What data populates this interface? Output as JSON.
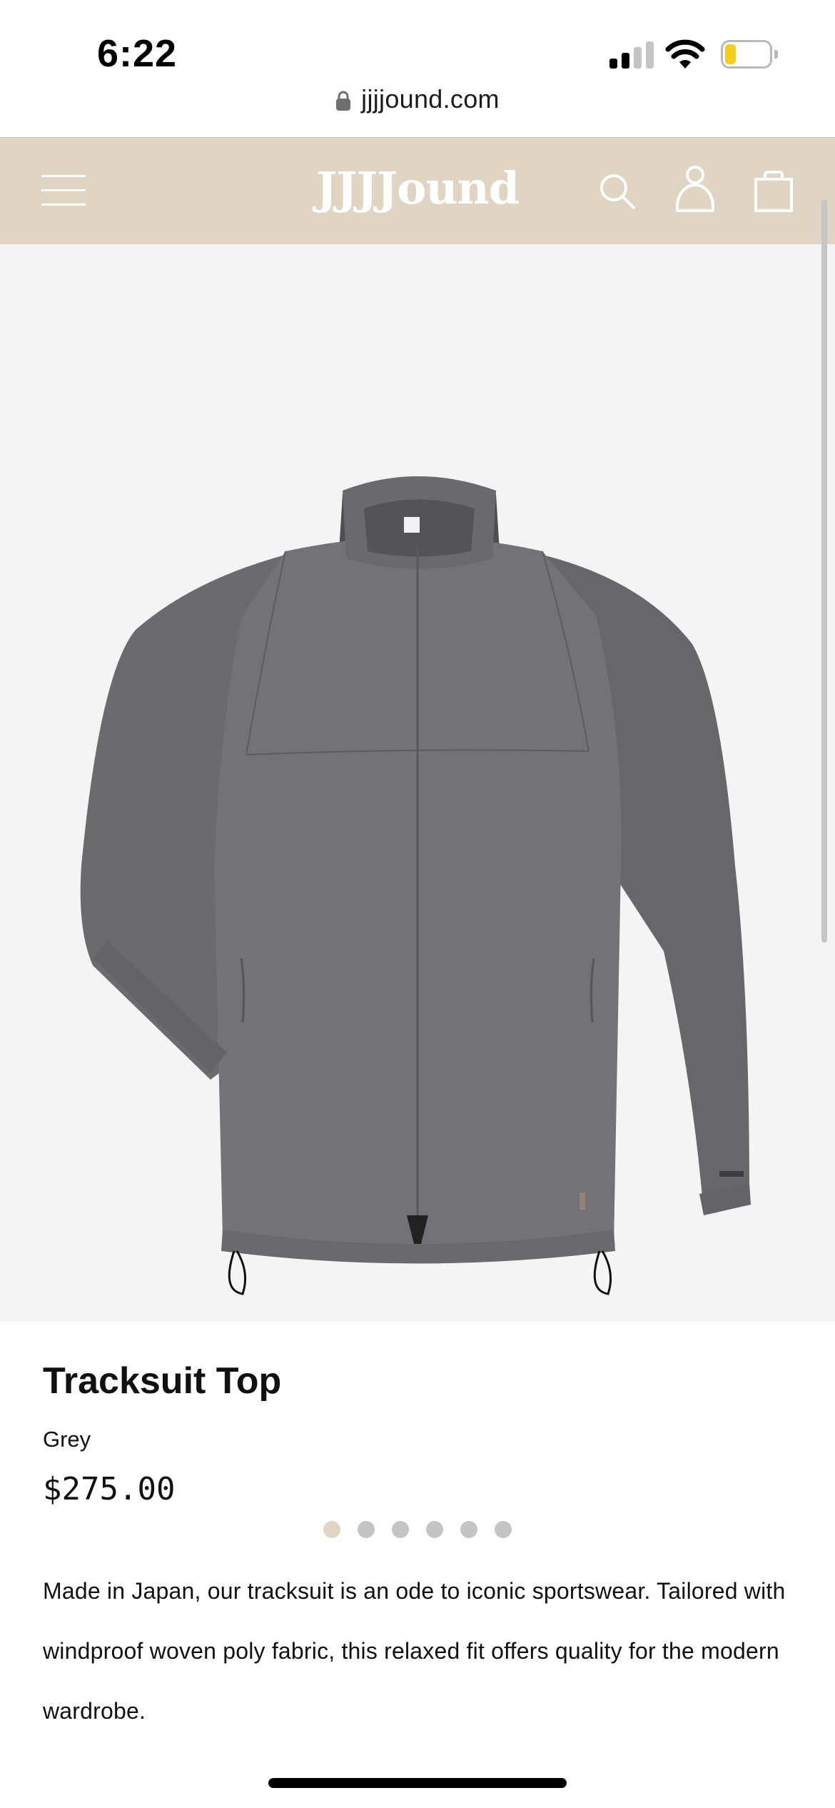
{
  "status_bar": {
    "time": "6:22",
    "battery_level": 0.25,
    "battery_color": "#f5cd1d"
  },
  "browser": {
    "url": "jjjjound.com",
    "lock_icon": "lock-icon"
  },
  "header": {
    "brand": "JJJJound",
    "background": "#e0d5c3",
    "icons": [
      "menu-icon",
      "search-icon",
      "account-icon",
      "cart-icon"
    ]
  },
  "gallery": {
    "image_subject": "grey tracksuit jacket",
    "image_count": 6,
    "active_index": 0
  },
  "product": {
    "title": "Tracksuit Top",
    "color": "Grey",
    "price": "$275.00",
    "description": "Made in Japan, our tracksuit is an ode to iconic sportswear. Tailored with windproof woven poly fabric, this relaxed fit offers quality for the modern wardrobe."
  }
}
